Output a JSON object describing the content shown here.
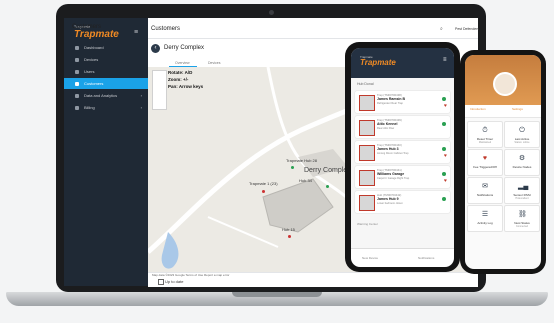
{
  "laptop": {
    "brand_small": "Trapmate",
    "brand": "Trapmate",
    "nav": [
      {
        "label": "Dashboard",
        "active": false
      },
      {
        "label": "Devices",
        "active": false
      },
      {
        "label": "Users",
        "active": false
      },
      {
        "label": "Customers",
        "active": true
      },
      {
        "label": "Data and Analytics",
        "active": false
      },
      {
        "label": "Billing",
        "active": false
      }
    ],
    "page_title": "Customers",
    "user_name": "Pest Defenders",
    "site_name": "Derry Complex",
    "tabs": [
      "Overview",
      "Devices"
    ],
    "map_info": {
      "rotate": "Rotate: A/D",
      "zoom": "Zoom: +/-",
      "pan": "Pan: Arrow keys"
    },
    "map_labels": [
      "Trapmate Hub 28",
      "Derry Complex",
      "Hub 34",
      "Trapmate 1 (23)",
      "Hub 15"
    ],
    "map_credit": "Map data ©2023 Google  Terms of Use  Report a map error",
    "upto_label": "Up to date"
  },
  "phone1": {
    "brand_small": "Trapmate",
    "brand": "Trapmate",
    "section": "Hub Donal",
    "cards": [
      {
        "id": "Trap (TM00700438)",
        "name": "James Ramsin B",
        "l1": "Refrigerator Rear Trap",
        "l2": "Last Active: 2d 7hr 23 hr"
      },
      {
        "id": "Trap (TM00700439)",
        "name": "Attic Kennel",
        "l1": "Rear Attic Row",
        "l2": "Last Active: 2d 7hr 23 hr"
      },
      {
        "id": "Trap (TM00700440)",
        "name": "James Hub 3",
        "l1": "Among Room Cabinet Trap",
        "l2": "Last Active: 2d 7hr 23 hr"
      },
      {
        "id": "Trap (TM00700441)",
        "name": "Williams Garage",
        "l1": "Carport / Garage Right Trap",
        "l2": "Last Active: 2d 7hr 23 hr"
      },
      {
        "id": "Hub (TM00700442)",
        "name": "James Hub 9",
        "l1": "Lower bedroom closet",
        "l2": "Last Active: 2d 7hr 23 hr"
      }
    ],
    "warning": "Warning Center",
    "foot": [
      "New Device",
      "Notifications"
    ]
  },
  "phone2": {
    "tabs": [
      "Introduction",
      "Settings"
    ],
    "tiles": [
      {
        "label": "Reset Timer",
        "sub": "Maintained",
        "icon": "⏱"
      },
      {
        "label": "Last Active",
        "sub": "Status: online",
        "icon": "⏻"
      },
      {
        "label": "Fee Triggered/Off",
        "sub": "",
        "icon": "♥"
      },
      {
        "label": "Device Nodes",
        "sub": "",
        "icon": "⚙"
      },
      {
        "label": "Notifications",
        "sub": "",
        "icon": "✉"
      },
      {
        "label": "Sensor RSSI",
        "sub": "Hi-Excellent",
        "icon": "📶"
      },
      {
        "label": "Activity Log",
        "sub": "",
        "icon": "☰"
      },
      {
        "label": "Nest Status",
        "sub": "Connected",
        "icon": "🔗"
      }
    ]
  }
}
